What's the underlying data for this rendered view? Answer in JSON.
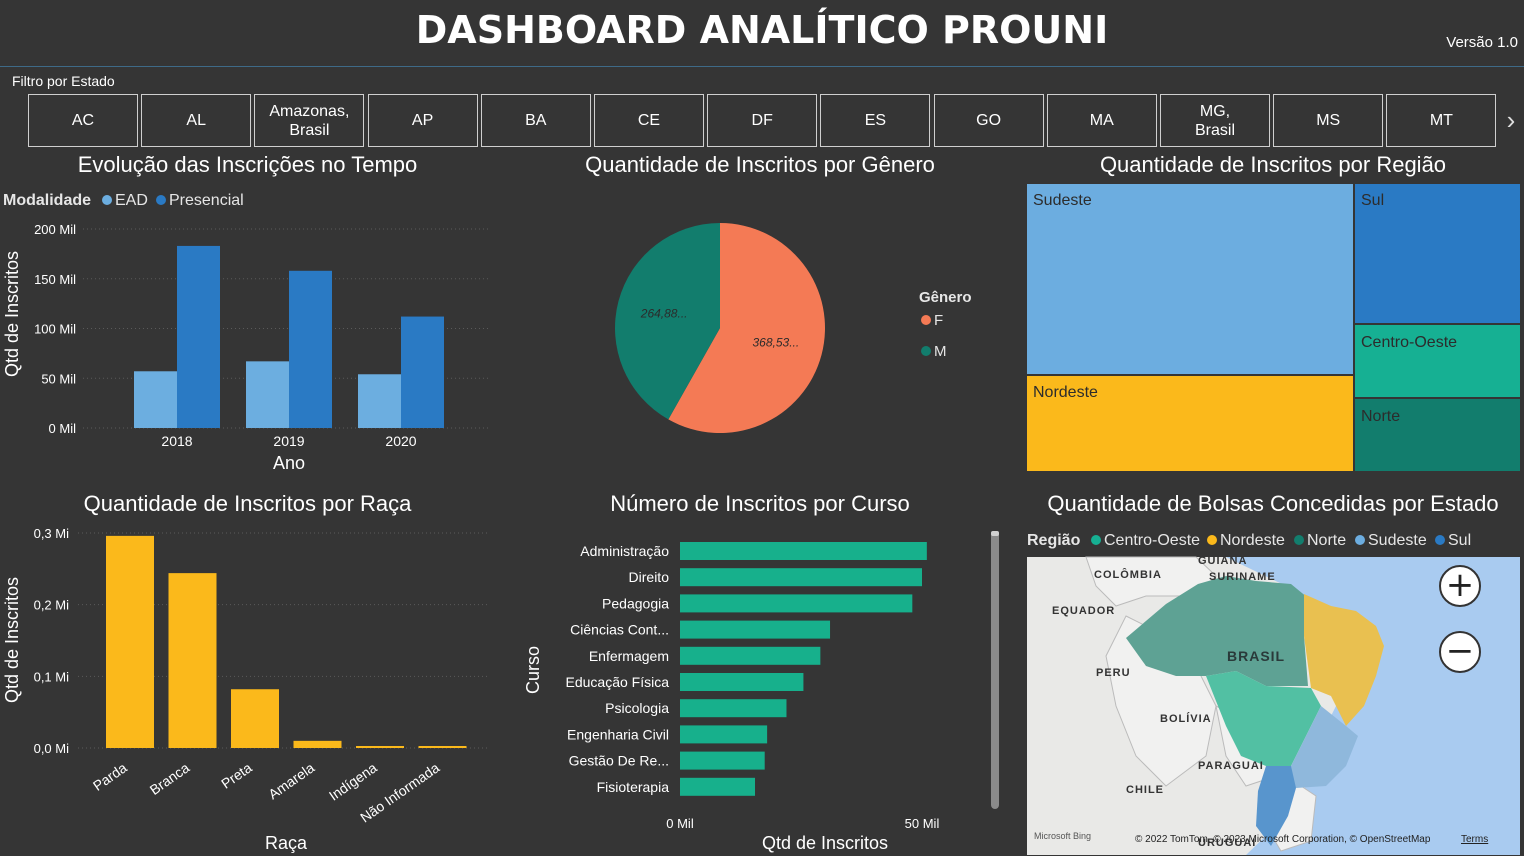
{
  "header": {
    "title": "DASHBOARD ANALÍTICO PROUNI",
    "version": "Versão 1.0"
  },
  "filter": {
    "label": "Filtro por Estado",
    "states": [
      "AC",
      "AL",
      "Amazonas, Brasil",
      "AP",
      "BA",
      "CE",
      "DF",
      "ES",
      "GO",
      "MA",
      "MG, Brasil",
      "MS",
      "MT"
    ],
    "next_icon": "chevron-right-icon"
  },
  "colors": {
    "background": "#353535",
    "ead": "#6caee0",
    "presencial": "#2a7ac4",
    "female": "#f47a55",
    "male": "#127d6d",
    "race": "#fbb91b",
    "course": "#17b08c",
    "sudeste": "#6cade0",
    "sul": "#2a7ac4",
    "centro_oeste": "#16b093",
    "nordeste": "#fbb91b",
    "norte": "#127d6d"
  },
  "chart_data": [
    {
      "id": "inscricoes_tempo",
      "type": "bar",
      "title": "Evolução das Inscrições no Tempo",
      "legend_title": "Modalidade",
      "legend_placement": "top-left",
      "xlabel": "Ano",
      "ylabel": "Qtd de Inscritos",
      "categories": [
        "2018",
        "2019",
        "2020"
      ],
      "series": [
        {
          "name": "EAD",
          "values": [
            57000,
            67000,
            54000
          ]
        },
        {
          "name": "Presencial",
          "values": [
            183000,
            158000,
            112000
          ]
        }
      ],
      "yticks": [
        "0 Mil",
        "50 Mil",
        "100 Mil",
        "150 Mil",
        "200 Mil"
      ],
      "ylim": [
        0,
        200000
      ],
      "grid": true
    },
    {
      "id": "genero",
      "type": "pie",
      "title": "Quantidade de Inscritos por Gênero",
      "legend_title": "Gênero",
      "legend_placement": "right",
      "slices": [
        {
          "name": "F",
          "value": 368530,
          "label": "368,53..."
        },
        {
          "name": "M",
          "value": 264880,
          "label": "264,88..."
        }
      ]
    },
    {
      "id": "regiao",
      "type": "treemap",
      "title": "Quantidade de Inscritos por Região",
      "items": [
        {
          "name": "Sudeste"
        },
        {
          "name": "Sul"
        },
        {
          "name": "Centro-Oeste"
        },
        {
          "name": "Nordeste"
        },
        {
          "name": "Norte"
        }
      ]
    },
    {
      "id": "raca",
      "type": "bar",
      "title": "Quantidade de Inscritos por Raça",
      "xlabel": "Raça",
      "ylabel": "Qtd de Inscritos",
      "categories": [
        "Parda",
        "Branca",
        "Preta",
        "Amarela",
        "Indígena",
        "Não Informada"
      ],
      "values": [
        296000,
        244000,
        82000,
        10000,
        2000,
        2000
      ],
      "yticks": [
        "0,0 Mi",
        "0,1 Mi",
        "0,2 Mi",
        "0,3 Mi"
      ],
      "ylim": [
        0,
        300000
      ],
      "grid": true
    },
    {
      "id": "curso",
      "type": "bar",
      "orientation": "horizontal",
      "title": "Número de Inscritos por Curso",
      "xlabel": "Qtd de Inscritos",
      "ylabel": "Curso",
      "categories": [
        "Administração",
        "Direito",
        "Pedagogia",
        "Ciências Cont...",
        "Enfermagem",
        "Educação Física",
        "Psicologia",
        "Engenharia Civil",
        "Gestão De Re...",
        "Fisioterapia"
      ],
      "values": [
        51000,
        50000,
        48000,
        31000,
        29000,
        25500,
        22000,
        18000,
        17500,
        15500
      ],
      "xticks": [
        "0 Mil",
        "50 Mil"
      ],
      "xlim": [
        0,
        50000
      ]
    }
  ],
  "map": {
    "title": "Quantidade de Bolsas Concedidas por Estado",
    "legend_title": "Região",
    "legend": [
      "Centro-Oeste",
      "Nordeste",
      "Norte",
      "Sudeste",
      "Sul"
    ],
    "labels": [
      "COLÔMBIA",
      "GUIANA",
      "SURINAME",
      "EQUADOR",
      "PERU",
      "BRASIL",
      "BOLÍVIA",
      "PARAGUAI",
      "CHILE",
      "URUGUAI"
    ],
    "attribution": "© 2022 TomTom, © 2023 Microsoft Corporation, © OpenStreetMap",
    "terms": "Terms",
    "bing": "Microsoft Bing",
    "zoom_in": "+",
    "zoom_out": "−"
  }
}
